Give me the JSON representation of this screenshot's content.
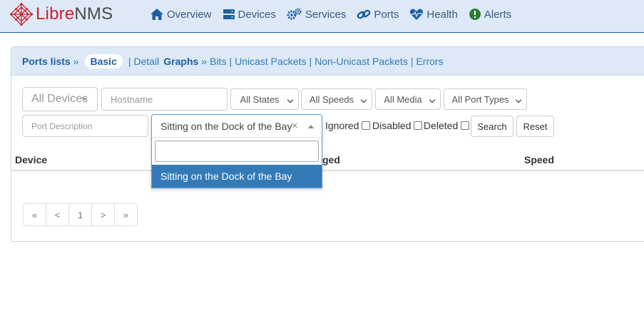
{
  "brand": {
    "part1": "Libre",
    "part2": "NMS"
  },
  "nav": [
    {
      "label": "Overview",
      "icon": "home-icon"
    },
    {
      "label": "Devices",
      "icon": "server-icon"
    },
    {
      "label": "Services",
      "icon": "cogs-icon"
    },
    {
      "label": "Ports",
      "icon": "link-icon"
    },
    {
      "label": "Health",
      "icon": "heartbeat-icon"
    },
    {
      "label": "Alerts",
      "icon": "exclamation-circle-icon"
    }
  ],
  "heading": {
    "ports_lists": "Ports lists",
    "raquo1": "»",
    "basic": "Basic",
    "sep1": "|",
    "detail": "Detail",
    "graphs": "Graphs",
    "raquo2": "»",
    "bits": "Bits",
    "sep2": "|",
    "unicast": "Unicast Packets",
    "sep3": "|",
    "nonunicast": "Non-Unicast Packets",
    "sep4": "|",
    "errors": "Errors"
  },
  "filters": {
    "all_devices": "All Devices",
    "hostname_placeholder": "Hostname",
    "states": "All States",
    "speeds": "All Speeds",
    "media": "All Media",
    "port_types": "All Port Types",
    "port_description_placeholder": "Port Description",
    "selected_description": "Sitting on the Dock of the Bay",
    "clear_symbol": "×",
    "dropdown_option": "Sitting on the Dock of the Bay",
    "ignored_label": "Ignored",
    "disabled_label": "Disabled",
    "deleted_label": "Deleted",
    "search_button": "Search",
    "reset_button": "Reset"
  },
  "table": {
    "col_device": "Device",
    "col_partial": "ged",
    "col_speed": "Speed"
  },
  "pagination": [
    "«",
    "<",
    "1",
    ">",
    "»"
  ],
  "colors": {
    "navbar_bg": "#dde9f7",
    "link": "#337ab7",
    "brand_red": "#d0202a",
    "selected_option": "#337ab7"
  }
}
